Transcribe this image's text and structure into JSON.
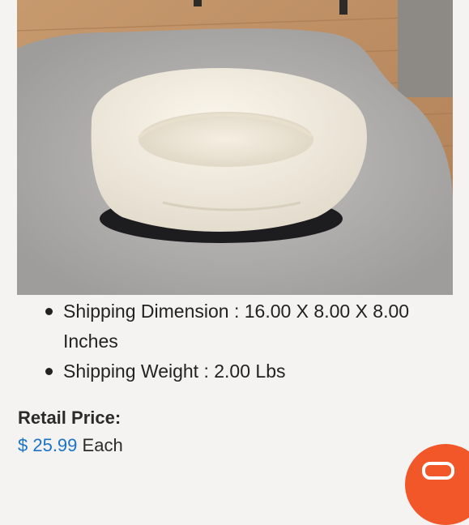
{
  "product": {
    "specs": [
      {
        "label": "Shipping Dimension : 16.00 X 8.00 X 8.00 Inches"
      },
      {
        "label": "Shipping Weight : 2.00 Lbs"
      }
    ]
  },
  "pricing": {
    "retail_label": "Retail Price:",
    "price": "$ 25.99",
    "unit": "Each"
  },
  "colors": {
    "price": "#1a73c9",
    "chat_button": "#f2572a",
    "background": "#f4f3f1"
  },
  "icons": {
    "chat": "chat-bubble-icon"
  }
}
